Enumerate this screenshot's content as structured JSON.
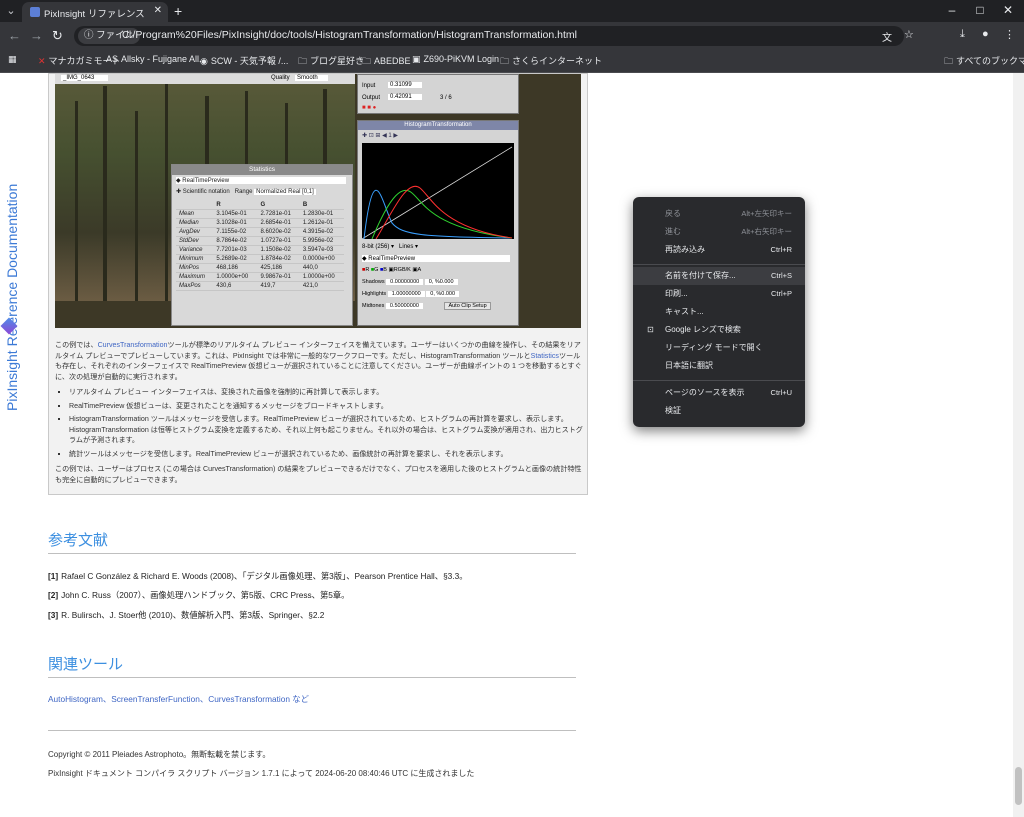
{
  "browser": {
    "tab_title": "PixInsight リファレンス ドキュメント",
    "address_chip": "ファイル",
    "url": "C:/Program%20Files/PixInsight/doc/tools/HistogramTransformation/HistogramTransformation.html",
    "bookmarks": [
      "マナカガミモート",
      "Allsky - Fujigane All...",
      "SCW - 天気予報 /...",
      "ブログ星好き",
      "ABEDBE",
      "Z690-PiKVM Login",
      "さくらインターネット"
    ],
    "all_bookmarks": "すべてのブックマーク"
  },
  "sidebar": {
    "brand": "PixInsight Reference Documentation"
  },
  "figure": {
    "statistics_title": "Statistics",
    "stat_view": "RealTimePreview",
    "stat_notation": "Scientific notation",
    "stat_range_label": "Range",
    "stat_range_value": "Normalized Real [0,1]",
    "stat_headers": [
      "",
      "R",
      "G",
      "B"
    ],
    "stat_rows": [
      [
        "Mean",
        "3.1045e-01",
        "2.7281e-01",
        "1.2830e-01"
      ],
      [
        "Median",
        "3.1028e-01",
        "2.6854e-01",
        "1.2612e-01"
      ],
      [
        "AvgDev",
        "7.1155e-02",
        "8.6020e-02",
        "4.3915e-02"
      ],
      [
        "StdDev",
        "8.7864e-02",
        "1.0727e-01",
        "5.9956e-02"
      ],
      [
        "Variance",
        "7.7201e-03",
        "1.1508e-02",
        "3.5947e-03"
      ],
      [
        "Minimum",
        "5.2689e-02",
        "1.8784e-02",
        "0.0000e+00"
      ],
      [
        "MinPos",
        "468,186",
        "425,186",
        "440,0"
      ],
      [
        "Maximum",
        "1.0000e+00",
        "9.9867e-01",
        "1.0000e+00"
      ],
      [
        "MaxPos",
        "430,6",
        "419,7",
        "421,0"
      ]
    ],
    "hist_title": "HistogramTransformation",
    "input_label": "Input",
    "input_value": "0.31099",
    "output_label": "Output",
    "output_value": "0.42091",
    "page_count": "3 / 6",
    "bits_label": "8-bit (256)",
    "lines_label": "Lines",
    "hist_view": "RealTimePreview",
    "shadows_label": "Shadows",
    "shadows_value": "0.00000000",
    "shadows_pct": "0, %0.000",
    "highlights_label": "Highlights",
    "highlights_value": "1.00000000",
    "highlights_pct": "0, %0.000",
    "midtones_label": "Midtones",
    "midtones_value": "0.50000000",
    "autoclip": "Auto Clip Setup",
    "preview_id": "_IMG_0643",
    "quality_label": "Quality",
    "quality_value": "Smooth"
  },
  "caption": {
    "p1_a": "この例では、",
    "p1_link1": "CurvesTransformation",
    "p1_b": "ツールが標準のリアルタイム プレビュー インターフェイスを備えています。ユーザーはいくつかの曲線を操作し、その結果をリアルタイム プレビューでプレビューしています。これは、PixInsight では非常に一般的なワークフローです。ただし、HistogramTransformation ツールと",
    "p1_link2": "Statistics",
    "p1_c": "ツールも存在し、それぞれのインターフェイスで RealTimePreview 仮想ビューが選択されていることに注意してください。ユーザーが曲線ポイントの 1 つを移動するとすぐに、次の処理が自動的に実行されます。",
    "items": [
      "リアルタイム プレビュー インターフェイスは、変換された画像を強制的に再計算して表示します。",
      "RealTimePreview 仮想ビューは、変更されたことを通知するメッセージをブロードキャストします。",
      "HistogramTransformation ツールはメッセージを受信します。RealTimePreview ビューが選択されているため、ヒストグラムの再計算を要求し、表示します。HistogramTransformation は恒等ヒストグラム変換を定義するため、それ以上何も起こりません。それ以外の場合は、ヒストグラム変換が適用され、出力ヒストグラムが予測されます。",
      "統計ツールはメッセージを受信します。RealTimePreview ビューが選択されているため、画像統計の再計算を要求し、それを表示します。"
    ],
    "p2": "この例では、ユーザーはプロセス (この場合は CurvesTransformation) の結果をプレビューできるだけでなく、プロセスを適用した後のヒストグラムと画像の統計特性も完全に自動的にプレビューできます。"
  },
  "references": {
    "heading": "参考文献",
    "items": [
      {
        "num": "[1]",
        "text": "Rafael C González & Richard E. Woods (2008)、「デジタル画像処理、第3版」、Pearson Prentice Hall、§3.3。"
      },
      {
        "num": "[2]",
        "text": "John C. Russ（2007）、画像処理ハンドブック、第5版、CRC Press、第5章。"
      },
      {
        "num": "[3]",
        "text": "R. Bulirsch、J. Stoer他 (2010)、数値解析入門、第3版、Springer、§2.2"
      }
    ]
  },
  "related": {
    "heading": "関連ツール",
    "links": [
      "AutoHistogram",
      "ScreenTransferFunction",
      "CurvesTransformation"
    ],
    "sep": "、",
    "suffix": " など"
  },
  "footer": {
    "copyright": "Copyright © 2011 Pleiades Astrophoto。無断転載を禁じます。",
    "generated": "PixInsight ドキュメント コンパイラ スクリプト バージョン 1.7.1 によって 2024-06-20 08:40:46 UTC に生成されました"
  },
  "context_menu": {
    "items": [
      {
        "label": "戻る",
        "shortcut": "Alt+左矢印キー",
        "dim": true
      },
      {
        "label": "進む",
        "shortcut": "Alt+右矢印キー",
        "dim": true
      },
      {
        "label": "再読み込み",
        "shortcut": "Ctrl+R",
        "dim": false
      },
      {
        "label": "名前を付けて保存...",
        "shortcut": "Ctrl+S",
        "dim": false
      },
      {
        "label": "印刷...",
        "shortcut": "Ctrl+P",
        "dim": false
      },
      {
        "label": "キャスト...",
        "shortcut": "",
        "dim": false
      },
      {
        "label": "Google レンズで検索",
        "shortcut": "",
        "dim": false
      },
      {
        "label": "リーディング モードで開く",
        "shortcut": "",
        "dim": false
      },
      {
        "label": "日本語に翻訳",
        "shortcut": "",
        "dim": false
      },
      {
        "label": "ページのソースを表示",
        "shortcut": "Ctrl+U",
        "dim": false
      },
      {
        "label": "検証",
        "shortcut": "",
        "dim": false
      }
    ]
  }
}
